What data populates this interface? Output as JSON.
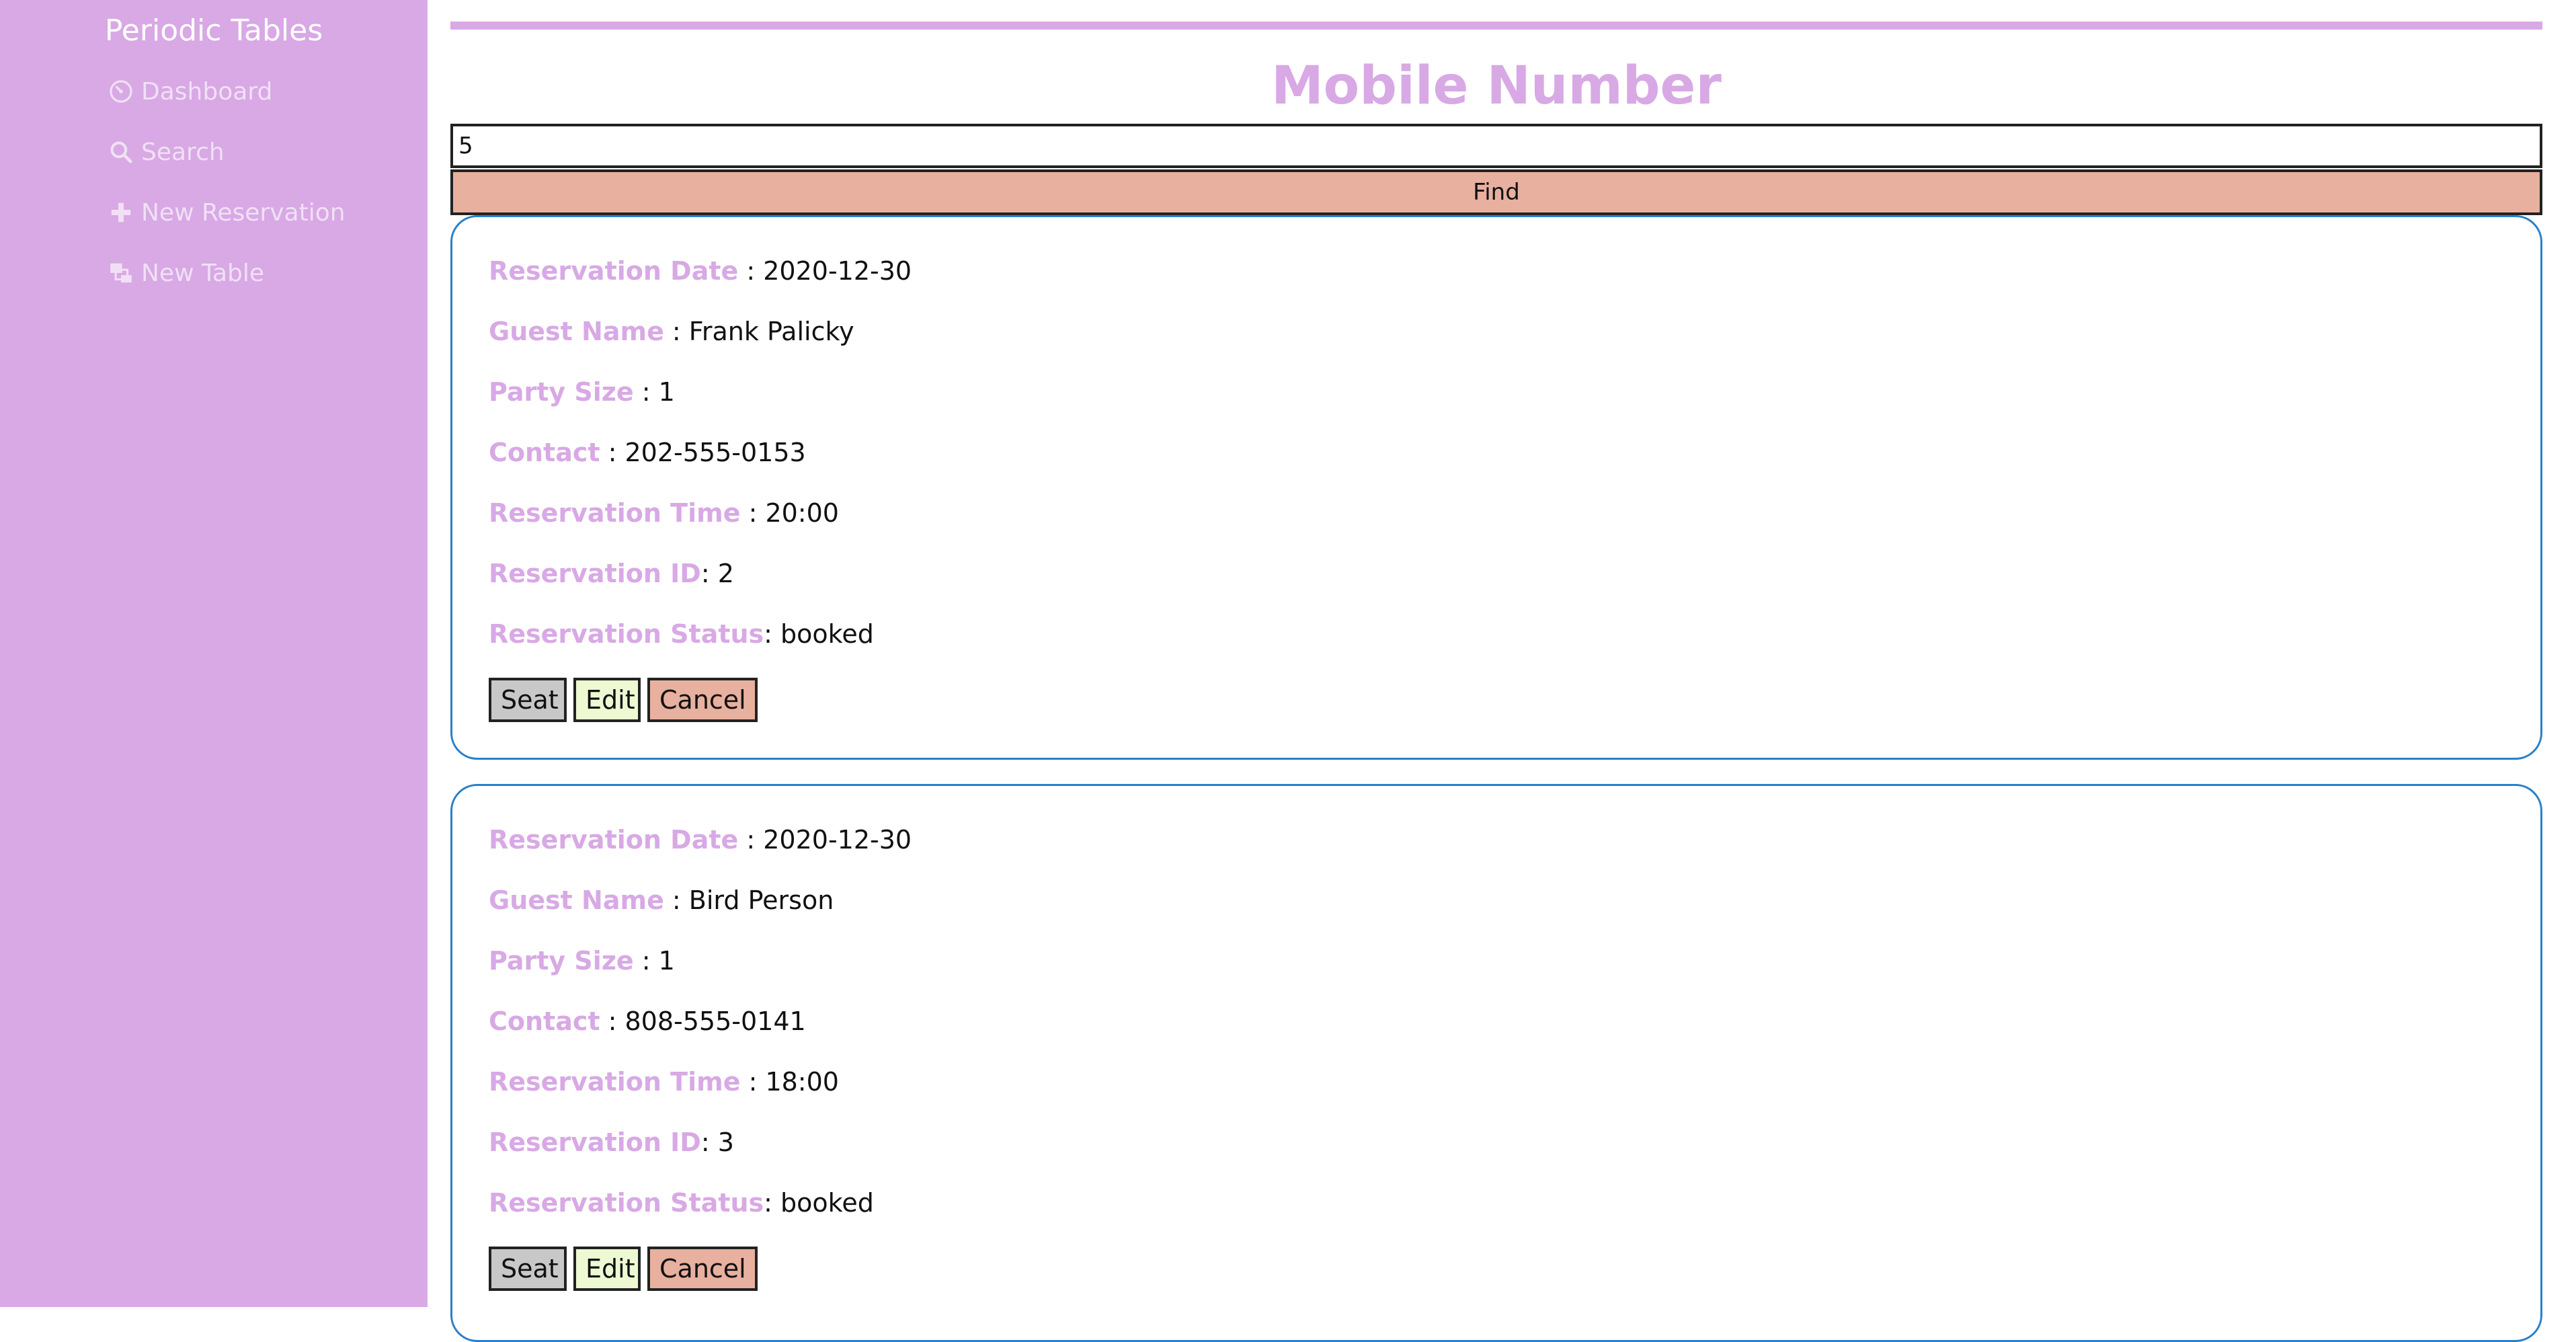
{
  "sidebar": {
    "brand": "Periodic Tables",
    "items": [
      {
        "label": "Dashboard",
        "icon": "dashboard-icon"
      },
      {
        "label": "Search",
        "icon": "search-icon"
      },
      {
        "label": "New Reservation",
        "icon": "plus-icon"
      },
      {
        "label": "New Table",
        "icon": "table-icon"
      }
    ]
  },
  "main": {
    "title": "Mobile Number",
    "search": {
      "value": "5",
      "button_label": "Find"
    },
    "labels": {
      "date": "Reservation Date",
      "guest": "Guest Name",
      "party": "Party Size",
      "contact": "Contact",
      "time": "Reservation Time",
      "id": "Reservation ID",
      "status": "Reservation Status"
    },
    "actions": {
      "seat": "Seat",
      "edit": "Edit",
      "cancel": "Cancel"
    },
    "reservations": [
      {
        "date": " : 2020-12-30",
        "guest": " : Frank Palicky",
        "party": " : 1",
        "contact": " : 202-555-0153",
        "time": " : 20:00",
        "id": ": 2",
        "status": ": booked"
      },
      {
        "date": " : 2020-12-30",
        "guest": " : Bird Person",
        "party": " : 1",
        "contact": " : 808-555-0141",
        "time": " : 18:00",
        "id": ": 3",
        "status": ": booked"
      }
    ]
  },
  "colors": {
    "accent": "#d8a9e5",
    "find_button": "#e8b09f",
    "seat_button": "#c8c8c8",
    "edit_button": "#edf9d2",
    "card_border": "#2a80c9"
  }
}
